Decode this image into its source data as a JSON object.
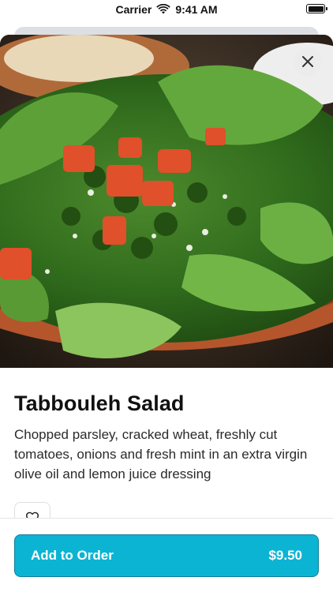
{
  "status_bar": {
    "carrier": "Carrier",
    "time": "9:41 AM"
  },
  "item": {
    "title": "Tabbouleh Salad",
    "description": "Chopped parsley, cracked wheat, freshly cut tomatoes, onions and fresh mint in an extra virgin olive oil and lemon juice dressing",
    "image_icon": "salad-photo"
  },
  "actions": {
    "close_icon": "close-icon",
    "favorite_icon": "heart-icon",
    "add_label": "Add to Order",
    "price": "$9.50"
  },
  "colors": {
    "accent": "#0cb4d4",
    "accent_border": "#0a7f99"
  }
}
